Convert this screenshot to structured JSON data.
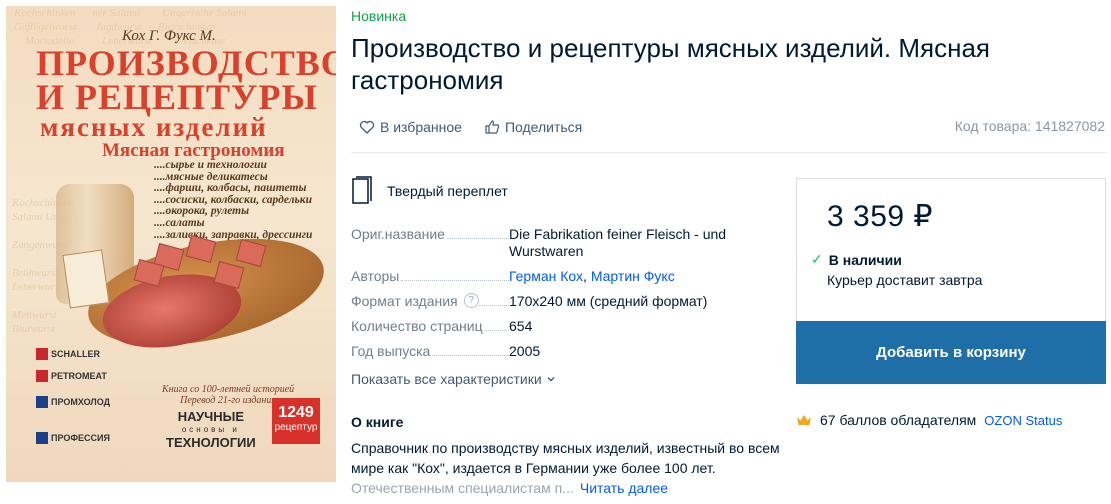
{
  "cover": {
    "authors": "Кох Г.  Фукс М.",
    "title_line1": "ПРОИЗВОДСТВО",
    "title_line2": "И РЕЦЕПТУРЫ",
    "title_line3": "мясных изделий",
    "title_line4": "Мясная гастрономия",
    "toc": [
      "....сырье и технологии",
      "....мясные деликатесы",
      "....фарши, колбасы, паштеты",
      "....сосиски, колбаски, сардельки",
      "....окорока, рулеты",
      "....салаты",
      "....заливки, заправки, дрессинги"
    ],
    "logos": [
      "SCHALLER",
      "PETROMEAT",
      "ПРОМХОЛОД",
      "ПРОФЕССИЯ"
    ],
    "note": "Книга со 100-летней историей\nПеревод 21-го издания",
    "series_line1": "НАУЧНЫЕ",
    "series_line2": "основы и",
    "series_line3": "ТЕХНОЛОГИИ",
    "badge_number": "1249",
    "badge_unit": "рецептур"
  },
  "badge": "Новинка",
  "title": "Производство и рецептуры мясных изделий. Мясная гастрономия",
  "actions": {
    "favorite": "В избранное",
    "share": "Поделиться"
  },
  "sku": "Код товара: 141827082",
  "binding": "Твердый переплет",
  "characteristics": [
    {
      "key": "Ориг.название",
      "value": "Die Fabrikation feiner Fleisch - und Wurstwaren"
    },
    {
      "key": "Авторы",
      "value": "Герман Кох, Мартин Фукс"
    },
    {
      "key": "Формат издания",
      "value": "170x240 мм (средний формат)"
    },
    {
      "key": "Количество страниц",
      "value": "654"
    },
    {
      "key": "Год выпуска",
      "value": "2005"
    }
  ],
  "authors": [
    "Герман Кох",
    "Мартин Фукс"
  ],
  "show_all": "Показать все характеристики",
  "about": {
    "heading": "О книге",
    "text": "Справочник по производству мясных изделий, известный во всем мире как \"Кох\", издается в Германии уже более 100 лет.",
    "text_faded": "Отечественным специалистам п...",
    "read_more": "Читать далее"
  },
  "buy": {
    "price": "3 359 ₽",
    "stock": "В наличии",
    "delivery": "Курьер доставит завтра",
    "add_to_cart": "Добавить в корзину"
  },
  "points": {
    "text": "67 баллов обладателям",
    "status": "OZON Status"
  },
  "colors": {
    "accent": "#005bff",
    "cart_button": "#1e6ea7",
    "badge_green": "#10a44b",
    "cover_red": "#d8412c"
  }
}
